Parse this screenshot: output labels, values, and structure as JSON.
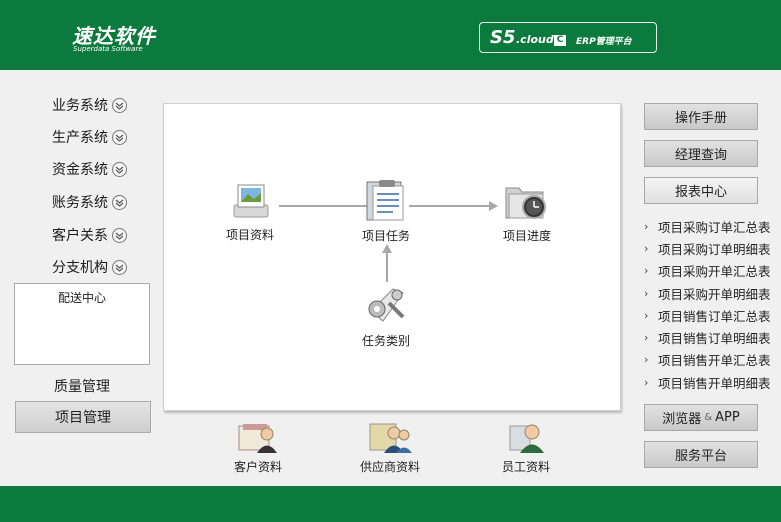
{
  "header": {
    "logo_main": "速达软件",
    "logo_sub": "Superdata Software",
    "platform_s5": "S5",
    "platform_cloud": ".cloud",
    "platform_c": "C",
    "platform_erp": "ERP管理平台",
    "accent_color": "#0c7a3c"
  },
  "sidebar": {
    "items": [
      {
        "label": "业务系统"
      },
      {
        "label": "生产系统"
      },
      {
        "label": "资金系统"
      },
      {
        "label": "账务系统"
      },
      {
        "label": "客户关系"
      },
      {
        "label": "分支机构"
      }
    ],
    "sub_item": "配送中心",
    "quality": "质量管理",
    "project": "项目管理"
  },
  "flow": {
    "materials": "项目资料",
    "tasks": "项目任务",
    "progress": "项目进度",
    "task_types": "任务类别"
  },
  "bottom": {
    "customer": "客户资料",
    "supplier": "供应商资料",
    "employee": "员工资料"
  },
  "right": {
    "manual": "操作手册",
    "manager_query": "经理查询",
    "report_center": "报表中心",
    "reports": [
      "项目采购订单汇总表",
      "项目采购订单明细表",
      "项目采购开单汇总表",
      "项目采购开单明细表",
      "项目销售订单汇总表",
      "项目销售订单明细表",
      "项目销售开单汇总表",
      "项目销售开单明细表"
    ],
    "browser_app_a": "浏览器",
    "browser_app_amp": "&",
    "browser_app_b": "APP",
    "service_platform": "服务平台"
  }
}
